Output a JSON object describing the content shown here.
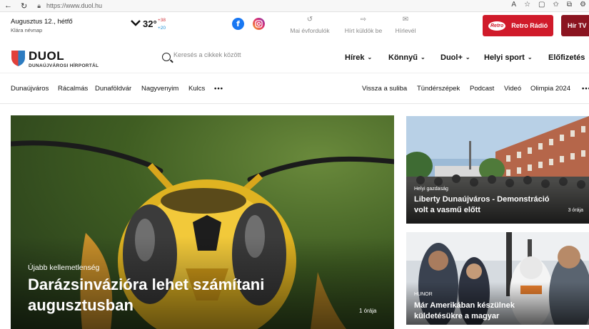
{
  "browser": {
    "url": "https://www.duol.hu"
  },
  "topbar": {
    "date": "Augusztus 12., hétfő",
    "nameday": "Klára névnap",
    "temperature": "32°",
    "temp_max": "+38",
    "temp_min": "+20",
    "links": [
      {
        "label": "Mai évfordulók",
        "icon": "history-icon"
      },
      {
        "label": "Hírt küldök be",
        "icon": "send-icon"
      },
      {
        "label": "Hírlevél",
        "icon": "mail-icon"
      }
    ],
    "radio_button": "Retro Rádió",
    "radio_logo": "Retro",
    "tv_button": "Hír TV"
  },
  "header": {
    "logo": "DUOL",
    "logo_sub": "DUNAÚJVÁROSI HÍRPORTÁL",
    "search_placeholder": "Keresés a cikkek között",
    "nav": [
      "Hírek",
      "Könnyű",
      "Duol+",
      "Helyi sport",
      "Előfizetés"
    ]
  },
  "subnav": {
    "left": [
      "Dunaújváros",
      "Rácalmás",
      "Dunaföldvár",
      "Nagyvenyim",
      "Kulcs"
    ],
    "right": [
      "Vissza a suliba",
      "Tündérszépek",
      "Podcast",
      "Videó",
      "Olimpia 2024"
    ],
    "more": "•••"
  },
  "hero": {
    "tag": "Újabb kellemetlenség",
    "title": "Darázsinvázióra lehet számítani augusztusban",
    "time": "1 órája"
  },
  "cards": [
    {
      "tag": "Helyi gazdaság",
      "title": "Liberty Dunaújváros - Demonstráció volt a vasmű előtt",
      "time": "3 órája"
    },
    {
      "tag": "HUNOR",
      "title": "Már Amerikában készülnek küldetésükre a magyar",
      "time": ""
    }
  ],
  "colors": {
    "brand_red": "#d01a2a",
    "tv_red": "#8b1420",
    "facebook": "#1877f2"
  }
}
